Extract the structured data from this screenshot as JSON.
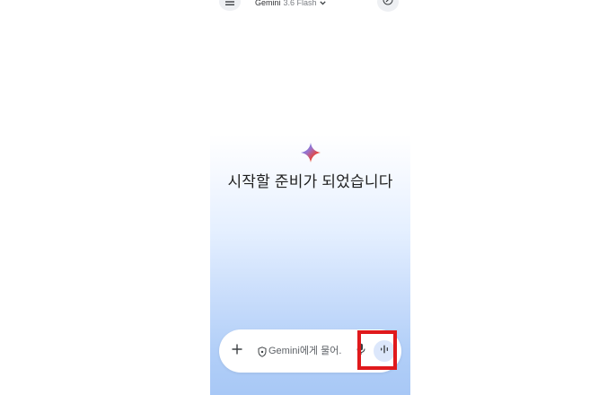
{
  "header": {
    "app_name": "Gemini",
    "model_name": "3.6 Flash",
    "icons": {
      "menu": "menu-icon",
      "model_dropdown": "chevron-down-icon",
      "new_chat": "edit-pencil-icon"
    }
  },
  "main": {
    "greeting": "시작할 준비가 되었습니다",
    "logo": "gemini-spark-icon"
  },
  "composer": {
    "placeholder": "Gemini에게 물어.",
    "icons": {
      "add": "plus-icon",
      "privacy": "shield-icon",
      "mic": "mic-icon",
      "voice": "waveform-icon"
    }
  },
  "annotation": {
    "color": "#e0191c",
    "target": "voice-button"
  },
  "colors": {
    "gradient_bottom": "#a8c8f6",
    "voice_button_bg": "#dce7fb",
    "text_primary": "#1f1f1f"
  }
}
